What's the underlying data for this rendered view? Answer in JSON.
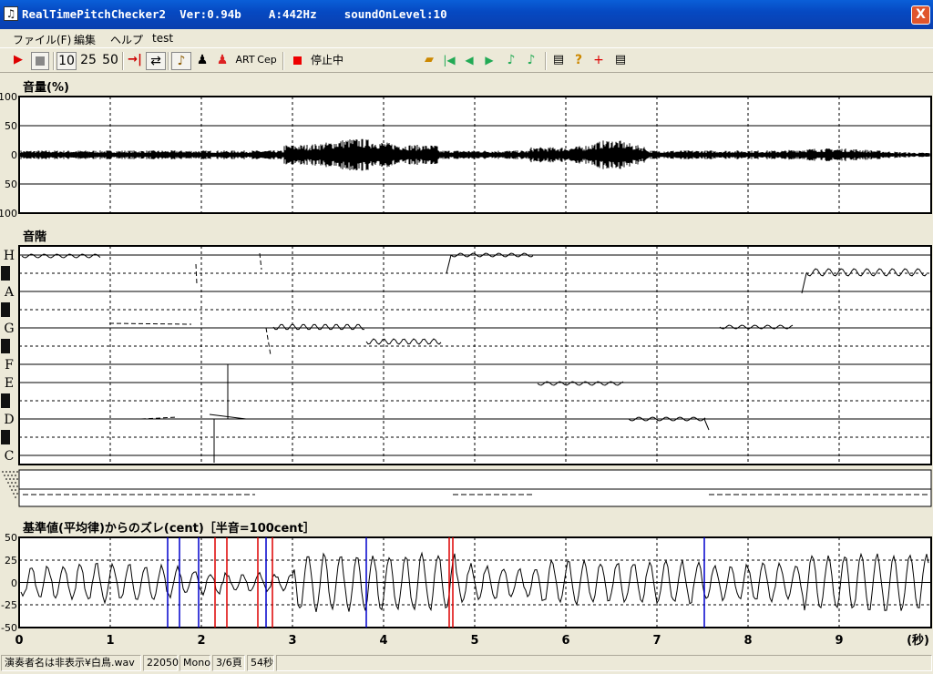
{
  "window": {
    "title": "RealTimePitchChecker2  Ver:0.94b    A:442Hz    soundOnLevel:10",
    "close_label": "X"
  },
  "menu": [
    "ファイル(F)",
    "編集",
    "ヘルプ",
    "test"
  ],
  "toolbar": {
    "speeds": [
      "10",
      "25",
      "50"
    ],
    "art": "ART",
    "cep": "Cep",
    "state": "停止中",
    "value": "＊＊＊"
  },
  "panels": {
    "volume": {
      "title": "音量(%)",
      "y_ticks": [
        "100",
        "50",
        "0",
        "50",
        "100"
      ]
    },
    "scale": {
      "title": "音階",
      "notes": [
        "H",
        "A",
        "G",
        "F",
        "E",
        "D",
        "C"
      ]
    },
    "deviation": {
      "title": "基準値(平均律)からのズレ(cent)［半音=100cent］",
      "y_ticks": [
        "50",
        "25",
        "0",
        "-25",
        "-50"
      ]
    }
  },
  "time_axis": {
    "ticks": [
      "0",
      "1",
      "2",
      "3",
      "4",
      "5",
      "6",
      "7",
      "8",
      "9"
    ],
    "unit": "(秒)"
  },
  "statusbar": [
    "演奏者名は非表示¥白鳥.wav",
    "22050",
    "Mono",
    "3/6頁",
    "54秒"
  ],
  "colors": {
    "titlebar": "#0a4fc4",
    "accent_blue": "#0000cc",
    "accent_red": "#dd0000",
    "plot_bg": "#ffffff"
  }
}
